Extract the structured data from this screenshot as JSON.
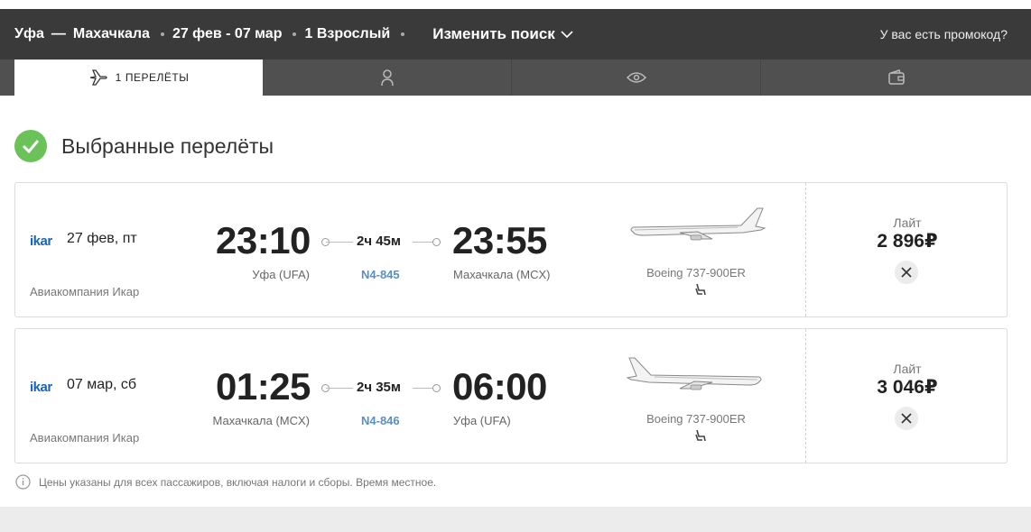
{
  "header": {
    "origin": "Уфа",
    "dash": "—",
    "destination": "Махачкала",
    "dates": "27 фев - 07 мар",
    "passengers": "1 Взрослый",
    "change_search": "Изменить поиск",
    "promo": "У вас есть промокод?"
  },
  "tabs": [
    {
      "count": "1",
      "label": "ПЕРЕЛЁТЫ",
      "icon": "airplane-icon"
    },
    {
      "icon": "passenger-icon"
    },
    {
      "icon": "eye-icon"
    },
    {
      "icon": "wallet-icon"
    }
  ],
  "section": {
    "title": "Выбранные перелёты",
    "icon": "check-icon"
  },
  "flights": [
    {
      "airline_logo": "ikar",
      "date": "27 фев, пт",
      "airline_name": "Авиакомпания Икар",
      "dep_time": "23:10",
      "dep_city": "Уфа (UFA)",
      "duration": "2ч 45м",
      "flight_no": "N4-845",
      "arr_time": "23:55",
      "arr_city": "Махачкала (MCX)",
      "aircraft": "Boeing 737-900ER",
      "fare": "Лайт",
      "price": "2 896₽"
    },
    {
      "airline_logo": "ikar",
      "date": "07 мар, сб",
      "airline_name": "Авиакомпания Икар",
      "dep_time": "01:25",
      "dep_city": "Махачкала (MCX)",
      "duration": "2ч 35м",
      "flight_no": "N4-846",
      "arr_time": "06:00",
      "arr_city": "Уфа (UFA)",
      "aircraft": "Boeing 737-900ER",
      "fare": "Лайт",
      "price": "3 046₽"
    }
  ],
  "note": "Цены указаны для всех пассажиров, включая налоги и сборы. Время местное.",
  "colors": {
    "topbar": "#3a3a3a",
    "tabs": "#505050",
    "check": "#6ac259",
    "flight_no": "#5c8fbf",
    "airline": "#1565c0"
  }
}
